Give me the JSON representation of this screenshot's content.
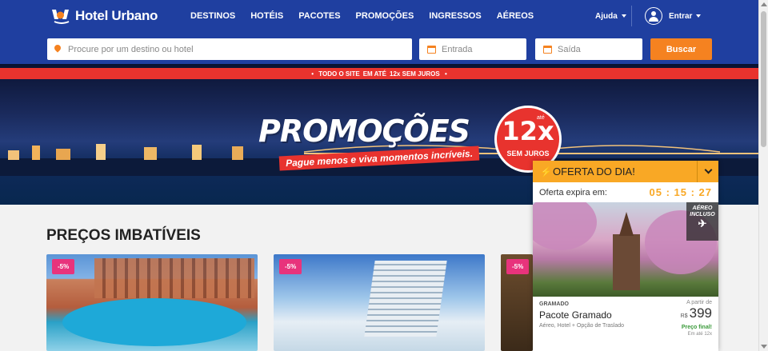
{
  "header": {
    "logo_text": "Hotel Urbano",
    "nav": [
      "DESTINOS",
      "HOTÉIS",
      "PACOTES",
      "PROMOÇÕES",
      "INGRESSOS",
      "AÉREOS"
    ],
    "help_label": "Ajuda",
    "login_label": "Entrar",
    "brand_color": "#1f3fa0",
    "accent_color": "#f58220"
  },
  "search": {
    "destination_placeholder": "Procure por um destino ou hotel",
    "checkin_placeholder": "Entrada",
    "checkout_placeholder": "Saída",
    "button_label": "Buscar"
  },
  "banner": {
    "strip_prefix": "TODO O SITE",
    "strip_mid": "EM ATÉ",
    "strip_highlight": "12x SEM JUROS",
    "headline": "PROMOÇÕES",
    "tagline": "Pague menos e viva momentos incríveis.",
    "badge_small": "até",
    "badge_number": "12x",
    "badge_text": "SEM JUROS"
  },
  "section": {
    "title": "PREÇOS IMBATÍVEIS"
  },
  "cards": [
    {
      "discount": "-5%"
    },
    {
      "discount": "-5%"
    },
    {
      "discount": "-5%"
    }
  ],
  "offer": {
    "title": "OFERTA DO DIA!",
    "expires_label": "Oferta expira em:",
    "timer": "05 : 15 : 27",
    "tag_line1": "AÉREO",
    "tag_line2": "INCLUSO",
    "city": "GRAMADO",
    "name": "Pacote Gramado",
    "description": "Aéreo, Hotel + Opção de Traslado",
    "from_label": "A partir de",
    "currency": "R$",
    "price": "399",
    "final_label": "Preço final!",
    "installments": "Em até 12x"
  }
}
